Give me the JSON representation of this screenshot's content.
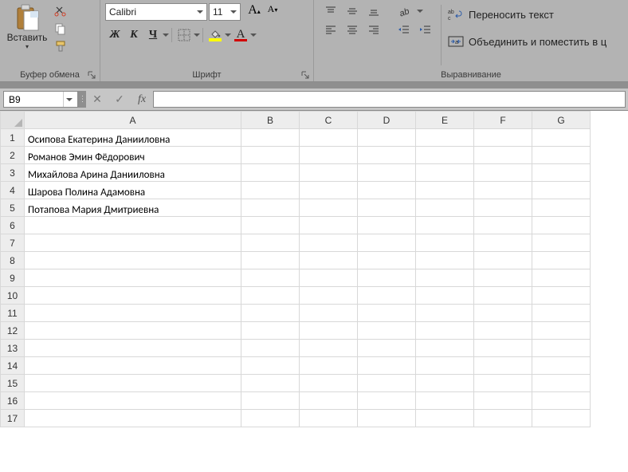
{
  "ribbon": {
    "clipboard": {
      "paste_label": "Вставить",
      "group_label": "Буфер обмена"
    },
    "font": {
      "family": "Calibri",
      "size": "11",
      "bold": "Ж",
      "italic": "К",
      "underline": "Ч",
      "group_label": "Шрифт"
    },
    "alignment": {
      "wrap_label": "Переносить текст",
      "merge_label": "Объединить и поместить в ц",
      "group_label": "Выравнивание"
    }
  },
  "formula_bar": {
    "namebox": "B9",
    "fx": "fx",
    "value": ""
  },
  "columns": [
    "A",
    "B",
    "C",
    "D",
    "E",
    "F",
    "G"
  ],
  "rows": [
    "1",
    "2",
    "3",
    "4",
    "5",
    "6",
    "7",
    "8",
    "9",
    "10",
    "11",
    "12",
    "13",
    "14",
    "15",
    "16",
    "17"
  ],
  "cells": {
    "A1": "Осипова Екатерина Данииловна",
    "A2": "Романов Эмин Фёдорович",
    "A3": "Михайлова Арина Данииловна",
    "A4": "Шарова Полина Адамовна",
    "A5": "Потапова Мария Дмитриевна"
  }
}
